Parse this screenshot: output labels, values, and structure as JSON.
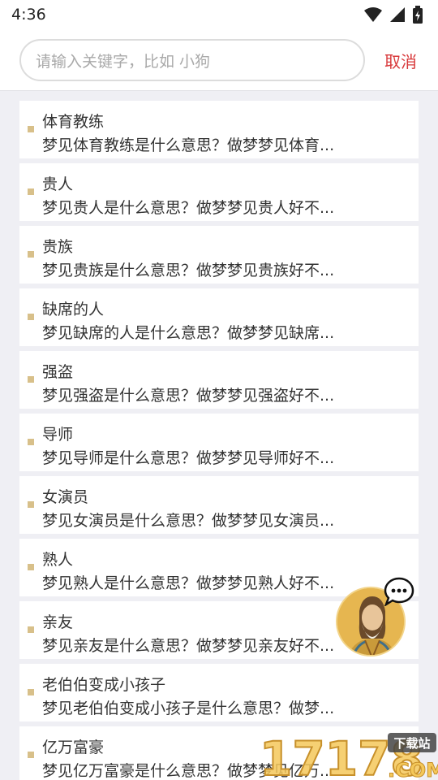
{
  "status": {
    "time": "4:36"
  },
  "search": {
    "placeholder": "请输入关键字，比如 小狗",
    "cancel_label": "取消"
  },
  "results": [
    {
      "title": "体育教练",
      "desc": "梦见体育教练是什么意思？做梦梦见体育..."
    },
    {
      "title": "贵人",
      "desc": "梦见贵人是什么意思？做梦梦见贵人好不..."
    },
    {
      "title": "贵族",
      "desc": "梦见贵族是什么意思？做梦梦见贵族好不..."
    },
    {
      "title": "缺席的人",
      "desc": "梦见缺席的人是什么意思？做梦梦见缺席..."
    },
    {
      "title": "强盗",
      "desc": "梦见强盗是什么意思？做梦梦见强盗好不..."
    },
    {
      "title": "导师",
      "desc": "梦见导师是什么意思？做梦梦见导师好不..."
    },
    {
      "title": "女演员",
      "desc": "梦见女演员是什么意思？做梦梦见女演员..."
    },
    {
      "title": "熟人",
      "desc": "梦见熟人是什么意思？做梦梦见熟人好不..."
    },
    {
      "title": "亲友",
      "desc": "梦见亲友是什么意思？做梦梦见亲友好不..."
    },
    {
      "title": "老伯伯变成小孩子",
      "desc": "梦见老伯伯变成小孩子是什么意思？做梦..."
    },
    {
      "title": "亿万富豪",
      "desc": "梦见亿万富豪是什么意思？做梦梦见亿万..."
    }
  ],
  "watermark": {
    "number": "17178",
    "tag": "下载站",
    "domain": ".COM"
  },
  "colors": {
    "accent": "#d8393b",
    "bullet": "#d8c08a",
    "background": "#efeff4"
  },
  "icons": {
    "wifi": "wifi-icon",
    "signal": "signal-icon",
    "battery": "battery-icon",
    "chat": "chat-bubble-icon"
  }
}
